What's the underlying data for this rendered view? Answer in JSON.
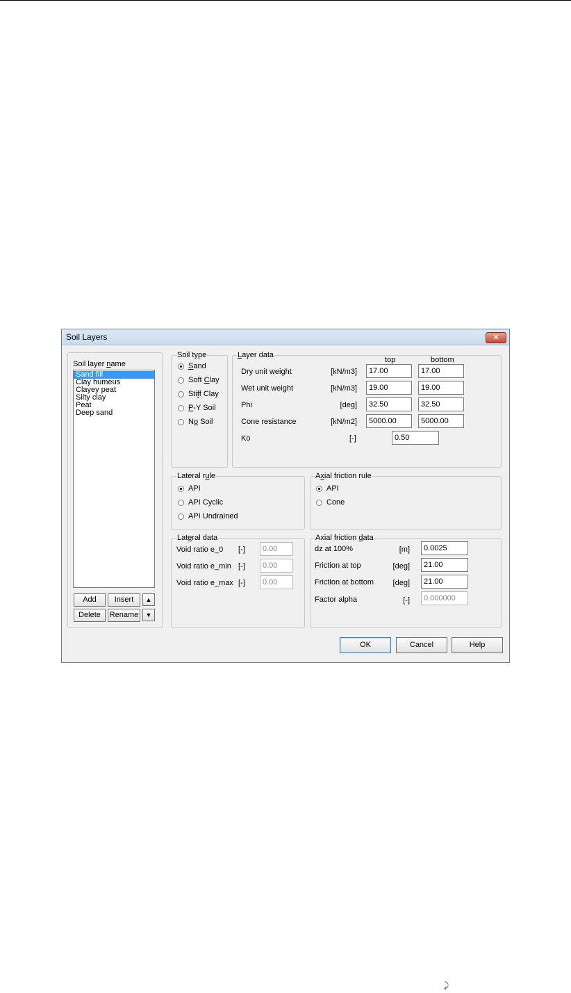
{
  "window": {
    "title": "Soil Layers",
    "close_glyph": "✕"
  },
  "soil_layer_panel": {
    "label_pre": "Soil layer ",
    "label_key": "n",
    "label_post": "ame",
    "items": [
      "Sand fill",
      "Clay humeus",
      "Clayey peat",
      "Silty clay",
      "Peat",
      "Deep sand"
    ],
    "selected_index": 0,
    "buttons": {
      "add": "Add",
      "insert": "Insert",
      "delete": "Delete",
      "rename": "Rename",
      "up_icon": "▲",
      "down_icon": "▼"
    }
  },
  "soil_type": {
    "legend": "Soil type",
    "options": [
      {
        "pre": "",
        "key": "S",
        "post": "and",
        "selected": true
      },
      {
        "pre": "Soft ",
        "key": "C",
        "post": "lay",
        "selected": false
      },
      {
        "pre": "Sti",
        "key": "f",
        "post": "f Clay",
        "selected": false
      },
      {
        "pre": "",
        "key": "P",
        "post": "-Y Soil",
        "selected": false
      },
      {
        "pre": "N",
        "key": "o",
        "post": " Soil",
        "selected": false
      }
    ]
  },
  "layer_data": {
    "legend_key": "L",
    "legend_post": "ayer data",
    "col_top": "top",
    "col_bottom": "bottom",
    "rows": [
      {
        "label": "Dry unit weight",
        "unit": "[kN/m3]",
        "top": "17.00",
        "bottom": "17.00"
      },
      {
        "label": "Wet unit weight",
        "unit": "[kN/m3]",
        "top": "19.00",
        "bottom": "19.00"
      },
      {
        "label": "Phi",
        "unit": "[deg]",
        "top": "32.50",
        "bottom": "32.50"
      },
      {
        "label": "Cone resistance",
        "unit": "[kN/m2]",
        "top": "5000.00",
        "bottom": "5000.00"
      }
    ],
    "ko": {
      "label": "Ko",
      "unit": "[-]",
      "value": "0.50"
    }
  },
  "lateral_rule": {
    "legend_pre": "Lateral r",
    "legend_key": "u",
    "legend_post": "le",
    "options": [
      {
        "label": "API",
        "selected": true
      },
      {
        "label": "API Cyclic",
        "selected": false
      },
      {
        "label": "API Undrained",
        "selected": false
      }
    ]
  },
  "axial_friction_rule": {
    "legend_pre": "A",
    "legend_key": "x",
    "legend_post": "ial friction rule",
    "options": [
      {
        "label": "API",
        "selected": true
      },
      {
        "label": "Cone",
        "selected": false
      }
    ]
  },
  "lateral_data": {
    "legend_pre": "Lat",
    "legend_key": "e",
    "legend_post": "ral data",
    "rows": [
      {
        "label": "Void ratio e_0",
        "unit": "[-]",
        "value": "0.00"
      },
      {
        "label": "Void ratio e_min",
        "unit": "[-]",
        "value": "0.00"
      },
      {
        "label": "Void ratio e_max",
        "unit": "[-]",
        "value": "0.00"
      }
    ]
  },
  "axial_friction_data": {
    "legend_pre": "Axial friction ",
    "legend_key": "d",
    "legend_post": "ata",
    "rows": [
      {
        "label": "dz at 100%",
        "unit": "[m]",
        "value": "0.0025"
      },
      {
        "label": "Friction at top",
        "unit": "[deg]",
        "value": "21.00"
      },
      {
        "label": "Friction at bottom",
        "unit": "[deg]",
        "value": "21.00"
      },
      {
        "label": "Factor alpha",
        "unit": "[-]",
        "value": "0.000000"
      }
    ]
  },
  "footer": {
    "ok": "OK",
    "cancel": "Cancel",
    "help": "Help"
  },
  "page_icon": "⤸"
}
